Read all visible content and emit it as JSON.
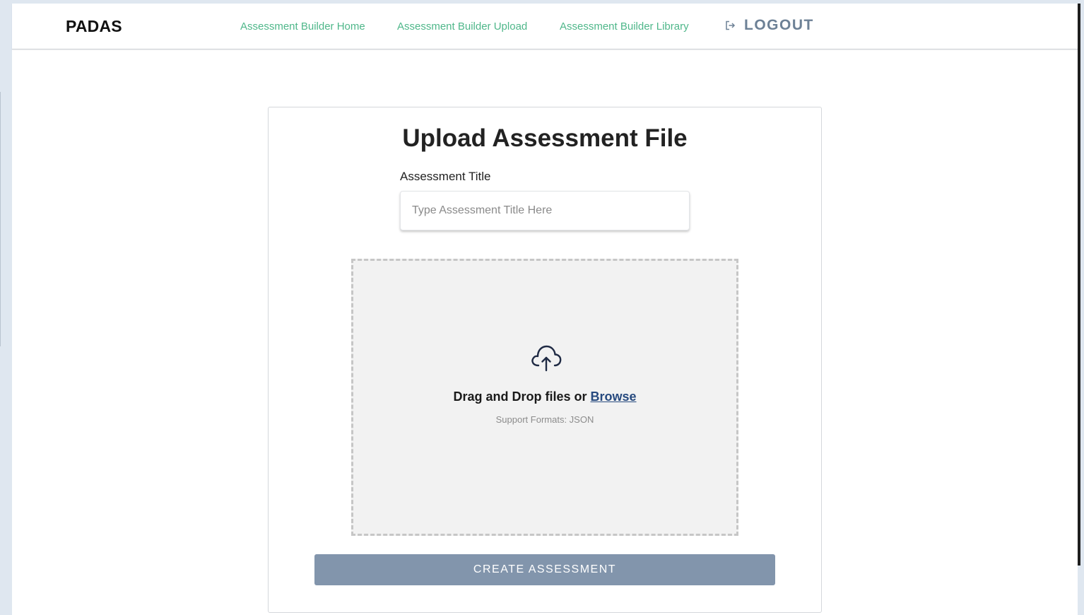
{
  "header": {
    "brand": "PADAS",
    "nav": {
      "home": "Assessment Builder Home",
      "upload": "Assessment Builder Upload",
      "library": "Assessment Builder Library"
    },
    "logout": {
      "label": "LOGOUT",
      "icon": "logout-icon"
    }
  },
  "card": {
    "title": "Upload Assessment File",
    "field_label": "Assessment Title",
    "input": {
      "value": "",
      "placeholder": "Type Assessment Title Here"
    },
    "dropzone": {
      "icon": "cloud-upload-icon",
      "prompt": "Drag and Drop files or ",
      "browse_label": "Browse",
      "formats": "Support Formats: JSON"
    },
    "create_label": "CREATE ASSESSMENT"
  },
  "colors": {
    "nav_link": "#4fb78a",
    "logout": "#6d8196",
    "browse_link": "#274a7f",
    "create_button": "#8295ac",
    "dropzone_bg": "#f2f2f2"
  }
}
